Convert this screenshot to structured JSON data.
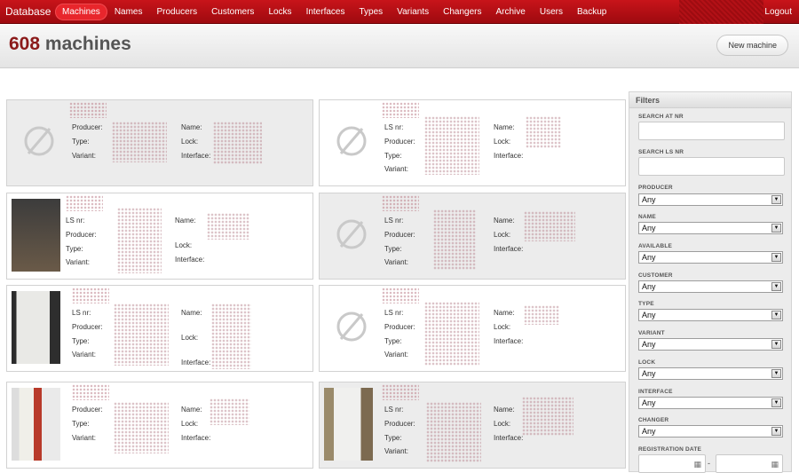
{
  "nav": {
    "brand": "Database",
    "items": [
      "Machines",
      "Names",
      "Producers",
      "Customers",
      "Locks",
      "Interfaces",
      "Types",
      "Variants",
      "Changers",
      "Archive",
      "Users",
      "Backup"
    ],
    "active": "Machines",
    "logout": "Logout"
  },
  "header": {
    "count": "608",
    "title_text": "machines",
    "new_button": "New machine"
  },
  "labels": {
    "ls_nr": "LS nr:",
    "producer": "Producer:",
    "type": "Type:",
    "variant": "Variant:",
    "name": "Name:",
    "lock": "Lock:",
    "interface": "Interface:"
  },
  "cards": [
    {
      "image": "none",
      "left_fields": [
        "Producer:",
        "Type:",
        "Variant:"
      ],
      "right_fields": [
        "Name:",
        "Lock:",
        "Interface:"
      ]
    },
    {
      "image": "none",
      "left_fields": [
        "LS nr:",
        "Producer:",
        "Type:",
        "Variant:"
      ],
      "right_fields": [
        "Name:",
        "Lock:",
        "Interface:"
      ]
    },
    {
      "image": "photo",
      "left_fields": [
        "LS nr:",
        "Producer:",
        "Type:",
        "Variant:"
      ],
      "right_fields": [
        "Name:",
        "Lock:",
        "Interface:"
      ]
    },
    {
      "image": "none",
      "left_fields": [
        "LS nr:",
        "Producer:",
        "Type:",
        "Variant:"
      ],
      "right_fields": [
        "Name:",
        "Lock:",
        "Interface:"
      ]
    },
    {
      "image": "photo",
      "left_fields": [
        "LS nr:",
        "Producer:",
        "Type:",
        "Variant:"
      ],
      "right_fields": [
        "Name:",
        "Lock:",
        "Interface:"
      ]
    },
    {
      "image": "none",
      "left_fields": [
        "LS nr:",
        "Producer:",
        "Type:",
        "Variant:"
      ],
      "right_fields": [
        "Name:",
        "Lock:",
        "Interface:"
      ]
    },
    {
      "image": "photo",
      "left_fields": [
        "Producer:",
        "Type:",
        "Variant:"
      ],
      "right_fields": [
        "Name:",
        "Lock:",
        "Interface:"
      ]
    },
    {
      "image": "photo",
      "left_fields": [
        "LS nr:",
        "Producer:",
        "Type:",
        "Variant:"
      ],
      "right_fields": [
        "Name:",
        "Lock:",
        "Interface:"
      ]
    }
  ],
  "filters": {
    "title": "Filters",
    "search_at": "SEARCH AT NR",
    "search_ls": "SEARCH LS NR",
    "selects": [
      {
        "label": "PRODUCER",
        "value": "Any"
      },
      {
        "label": "NAME",
        "value": "Any"
      },
      {
        "label": "AVAILABLE",
        "value": "Any"
      },
      {
        "label": "CUSTOMER",
        "value": "Any"
      },
      {
        "label": "TYPE",
        "value": "Any"
      },
      {
        "label": "VARIANT",
        "value": "Any"
      },
      {
        "label": "LOCK",
        "value": "Any"
      },
      {
        "label": "INTERFACE",
        "value": "Any"
      },
      {
        "label": "CHANGER",
        "value": "Any"
      }
    ],
    "registration_date": "REGISTRATION DATE",
    "date_separator": "-"
  },
  "colors": {
    "nav_red": "#b30f15",
    "count_color": "#8b1a1a",
    "card_grey": "#ececec"
  }
}
